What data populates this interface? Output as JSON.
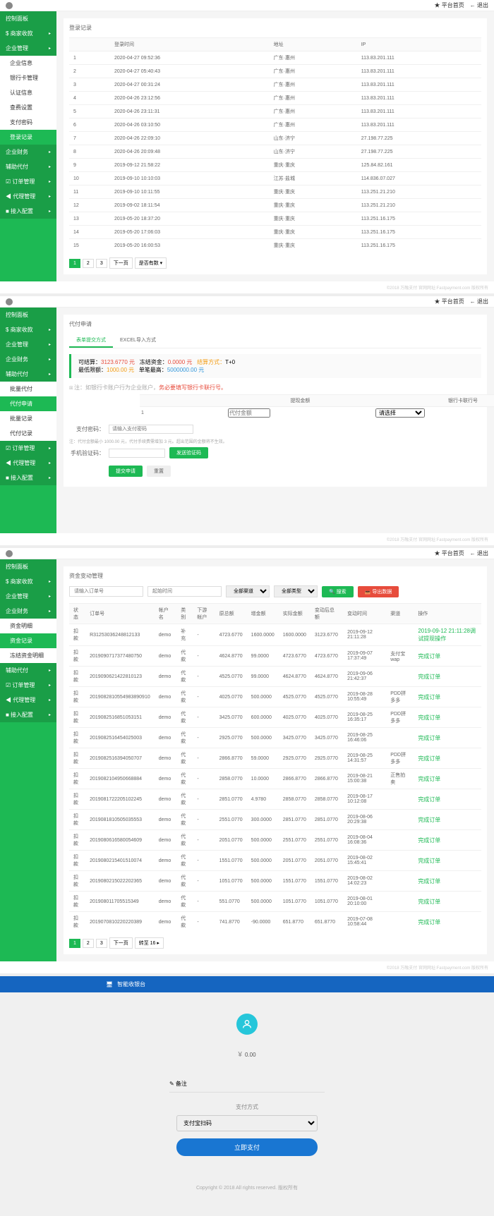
{
  "topbar": {
    "home": "★ 平台首页",
    "back": "← 退出"
  },
  "sidebar1": {
    "items": [
      {
        "label": "控制面板",
        "type": "dark"
      },
      {
        "label": "$ 商家收款",
        "type": "dark",
        "arrow": true
      },
      {
        "label": "企业管理",
        "type": "dark",
        "arrow": true
      },
      {
        "label": "企业信息",
        "type": "white"
      },
      {
        "label": "银行卡管理",
        "type": "white"
      },
      {
        "label": "认证信息",
        "type": "white"
      },
      {
        "label": "查费设置",
        "type": "white"
      },
      {
        "label": "支付密码",
        "type": "white"
      },
      {
        "label": "登录记录",
        "type": "active"
      },
      {
        "label": "企业财务",
        "type": "dark",
        "arrow": true
      },
      {
        "label": "辅助代付",
        "type": "dark",
        "arrow": true
      },
      {
        "label": "☑ 订单管理",
        "type": "dark",
        "arrow": true
      },
      {
        "label": "◀ 代理管理",
        "type": "dark",
        "arrow": true
      },
      {
        "label": "■ 接入配置",
        "type": "dark",
        "arrow": true
      }
    ]
  },
  "panel1": {
    "title": "登录记录",
    "headers": [
      "",
      "登录时间",
      "地址",
      "IP"
    ],
    "rows": [
      [
        "1",
        "2020-04-27 09:52:36",
        "广东·惠州",
        "113.83.201.111"
      ],
      [
        "2",
        "2020-04-27 05:40:43",
        "广东·惠州",
        "113.83.201.111"
      ],
      [
        "3",
        "2020-04-27 00:31:24",
        "广东·惠州",
        "113.83.201.111"
      ],
      [
        "4",
        "2020-04-26 23:12:56",
        "广东·惠州",
        "113.83.201.111"
      ],
      [
        "5",
        "2020-04-26 23:11:31",
        "广东·惠州",
        "113.83.201.111"
      ],
      [
        "6",
        "2020-04-26 03:10:50",
        "广东·惠州",
        "113.83.201.111"
      ],
      [
        "7",
        "2020-04-26 22:09:10",
        "山东·济宁",
        "27.198.77.225"
      ],
      [
        "8",
        "2020-04-26 20:09:48",
        "山东·济宁",
        "27.198.77.225"
      ],
      [
        "9",
        "2019-09-12 21:58:22",
        "重庆·重庆",
        "125.84.82.161"
      ],
      [
        "10",
        "2019-09-10 10:10:03",
        "江苏·盐城",
        "114.836.07.027"
      ],
      [
        "11",
        "2019-09-10 10:11:55",
        "重庆·重庆",
        "113.251.21.210"
      ],
      [
        "12",
        "2019-09-02 18:11:54",
        "重庆·重庆",
        "113.251.21.210"
      ],
      [
        "13",
        "2019-05-20 18:37:20",
        "重庆·重庆",
        "113.251.16.175"
      ],
      [
        "14",
        "2019-05-20 17:06:03",
        "重庆·重庆",
        "113.251.16.175"
      ],
      [
        "15",
        "2019-05-20 16:00:53",
        "重庆·重庆",
        "113.251.16.175"
      ]
    ],
    "pages": [
      "1",
      "2",
      "3",
      "下一页"
    ],
    "pagesize": "是否有数 ▾"
  },
  "footer": "©2018 万融支付 官网网址:Fastpayment.com 版权所有",
  "sidebar2": {
    "items": [
      {
        "label": "控制面板",
        "type": "dark"
      },
      {
        "label": "$ 商家收款",
        "type": "dark",
        "arrow": true
      },
      {
        "label": "企业管理",
        "type": "dark",
        "arrow": true
      },
      {
        "label": "企业财务",
        "type": "dark",
        "arrow": true
      },
      {
        "label": "辅助代付",
        "type": "dark",
        "arrow": true
      },
      {
        "label": "批量代付",
        "type": "white"
      },
      {
        "label": "代付申请",
        "type": "active"
      },
      {
        "label": "批量记录",
        "type": "white"
      },
      {
        "label": "代付记录",
        "type": "white"
      },
      {
        "label": "☑ 订单管理",
        "type": "dark",
        "arrow": true
      },
      {
        "label": "◀ 代理管理",
        "type": "dark",
        "arrow": true
      },
      {
        "label": "■ 接入配置",
        "type": "dark",
        "arrow": true
      }
    ]
  },
  "panel2": {
    "title": "代付申请",
    "tabs": [
      "表单提交方式",
      "EXCEL导入方式"
    ],
    "info": {
      "l1a": "可结算：",
      "l1b": "3123.6770 元",
      "l1c": "冻结资金：",
      "l1d": "0.0000 元",
      "l1e": "结算方式：",
      "l1f": "T+0",
      "l2a": "最低限额：",
      "l2b": "1000.00 元",
      "l2c": "单笔最高：",
      "l2d": "5000000.00 元"
    },
    "hint1": "注：如银行卡账户行为企业账户，",
    "hint1r": "务必要填写银行卡联行号。",
    "th1": "提现金额",
    "th2": "银行卡联行号",
    "amount_ph": "代付金额",
    "bank_ph": "请选择",
    "pwd_label": "支付密码：",
    "pwd_ph": "请输入支付密码",
    "hint2": "注：代付金额最小 1000.00 元，代付手续费需增加 3 元。超出范围的金额将不生效。",
    "code_label": "手机验证码：",
    "code_btn": "发送验证码",
    "submit": "提交申请",
    "reset": "重置"
  },
  "sidebar3": {
    "items": [
      {
        "label": "控制面板",
        "type": "dark"
      },
      {
        "label": "$ 商家收款",
        "type": "dark",
        "arrow": true
      },
      {
        "label": "企业管理",
        "type": "dark",
        "arrow": true
      },
      {
        "label": "企业财务",
        "type": "dark",
        "arrow": true
      },
      {
        "label": "资金明细",
        "type": "white"
      },
      {
        "label": "资金记录",
        "type": "active"
      },
      {
        "label": "冻结资金明细",
        "type": "white"
      },
      {
        "label": "辅助代付",
        "type": "dark",
        "arrow": true
      },
      {
        "label": "☑ 订单管理",
        "type": "dark",
        "arrow": true
      },
      {
        "label": "◀ 代理管理",
        "type": "dark",
        "arrow": true
      },
      {
        "label": "■ 接入配置",
        "type": "dark",
        "arrow": true
      }
    ]
  },
  "panel3": {
    "title": "资金变动管理",
    "filters": {
      "f1": "请输入订单号",
      "f2": "起始时间",
      "f3": "全部渠道",
      "f4": "全部类型",
      "search": "🔍 搜索",
      "export": "📥 导出数据"
    },
    "headers": [
      "状态",
      "订单号",
      "帐户名",
      "类别",
      "下游帐户",
      "原总额",
      "增金额",
      "实际金额",
      "变动后总额",
      "变动时间",
      "渠道",
      "操作"
    ],
    "rows": [
      [
        "扣款",
        "R31253036248812133",
        "demo",
        "补充",
        "-",
        "4723.6770",
        "1600.0000",
        "1600.0000",
        "3123.6770",
        "2019-09-12 21:11:28",
        "",
        "2019-09-12 21:11:28调试提现操作"
      ],
      [
        "扣款",
        "2019090717377480750",
        "demo",
        "代款",
        "-",
        "4624.8770",
        "99.0000",
        "4723.6770",
        "4723.6770",
        "2019-09-07 17:37:49",
        "支付宝wap",
        "完成订单"
      ],
      [
        "扣款",
        "2019090621422810123",
        "demo",
        "代款",
        "-",
        "4525.0770",
        "99.0000",
        "4624.8770",
        "4624.8770",
        "2019-09-06 21:42:37",
        "",
        "完成订单"
      ],
      [
        "扣款",
        "2019082810554983890910",
        "demo",
        "代款",
        "-",
        "4025.0770",
        "500.0000",
        "4525.0770",
        "4525.0770",
        "2019-08-28 10:55:49",
        "PDD拼多多",
        "完成订单"
      ],
      [
        "扣款",
        "2019082516851053151",
        "demo",
        "代款",
        "-",
        "3425.0770",
        "600.0000",
        "4025.0770",
        "4025.0770",
        "2019-08-25 16:35:17",
        "PDD拼多多",
        "完成订单"
      ],
      [
        "扣款",
        "2019082516454025003",
        "demo",
        "代款",
        "-",
        "2925.0770",
        "500.0000",
        "3425.0770",
        "3425.0770",
        "2019-08-25 16:46:06",
        "",
        "完成订单"
      ],
      [
        "扣款",
        "2019082516394050707",
        "demo",
        "代款",
        "-",
        "2866.8770",
        "59.0000",
        "2925.0770",
        "2925.0770",
        "2019-08-25 14:31:57",
        "PDD拼多多",
        "完成订单"
      ],
      [
        "扣款",
        "2019082104950668884",
        "demo",
        "代款",
        "-",
        "2858.0770",
        "10.0000",
        "2866.8770",
        "2866.8770",
        "2019-08-21 15:00:38",
        "正售拍卖",
        "完成订单"
      ],
      [
        "扣款",
        "2019081722205102245",
        "demo",
        "代款",
        "-",
        "2851.0770",
        "4.9780",
        "2858.0770",
        "2858.0770",
        "2019-08-17 10:12:08",
        "",
        "完成订单"
      ],
      [
        "扣款",
        "2019081810505035553",
        "demo",
        "代款",
        "-",
        "2551.0770",
        "300.0000",
        "2851.0770",
        "2851.0770",
        "2019-08-06 20:29:38",
        "",
        "完成订单"
      ],
      [
        "扣款",
        "2019080616580054609",
        "demo",
        "代款",
        "-",
        "2051.0770",
        "500.0000",
        "2551.0770",
        "2551.0770",
        "2019-08-04 16:08:36",
        "",
        "完成订单"
      ],
      [
        "扣款",
        "2019080215401510074",
        "demo",
        "代款",
        "-",
        "1551.0770",
        "500.0000",
        "2051.0770",
        "2051.0770",
        "2019-08-02 15:45:41",
        "",
        "完成订单"
      ],
      [
        "扣款",
        "2019080215022202365",
        "demo",
        "代款",
        "-",
        "1051.0770",
        "500.0000",
        "1551.0770",
        "1551.0770",
        "2019-08-02 14:02:23",
        "",
        "完成订单"
      ],
      [
        "扣款",
        "201908011705515349",
        "demo",
        "代款",
        "-",
        "551.0770",
        "500.0000",
        "1051.0770",
        "1051.0770",
        "2019-08-01 20:10:00",
        "",
        "完成订单"
      ],
      [
        "扣款",
        "2019070810220220389",
        "demo",
        "代款",
        "-",
        "741.8770",
        "-90.0000",
        "651.8770",
        "651.8770",
        "2019-07-08 10:58:44",
        "",
        "完成订单"
      ]
    ],
    "pages": [
      "1",
      "2",
      "3",
      "下一页"
    ],
    "goto": "转至 16 ▸"
  },
  "panel4": {
    "bar": "智能收银台",
    "amount": "0.00",
    "sym": "¥",
    "remark": "✎ 备注",
    "method_label": "支付方式",
    "method": "支付宝扫码",
    "paybtn": "立即支付",
    "copyright": "Copyright © 2018 All rights reserved. 版权所有"
  }
}
